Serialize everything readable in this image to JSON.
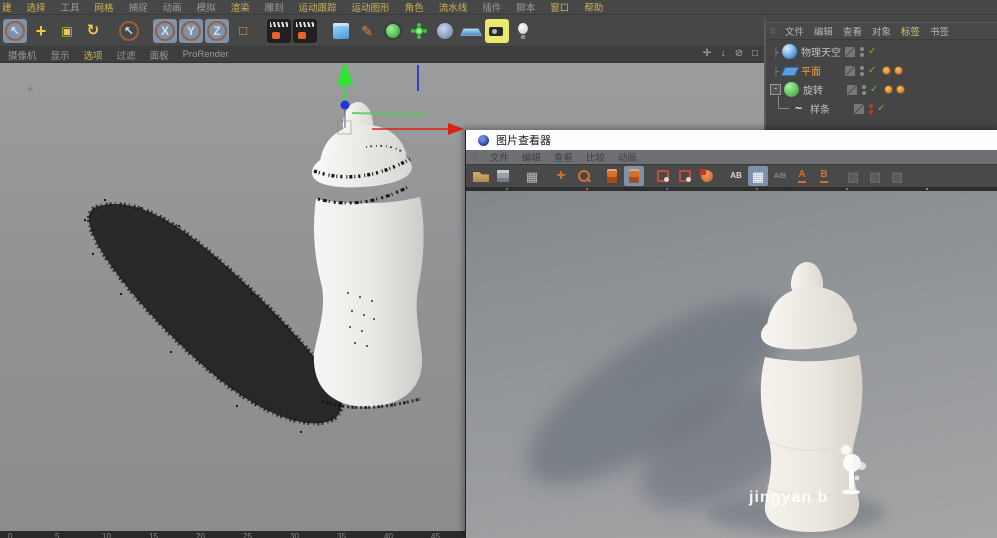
{
  "colors": {
    "accent_orange": "#e8a33d",
    "selected_blue": "#7d93ad",
    "camera_highlight": "#e9e96e",
    "check_green": "#57c13a",
    "tag_orange": "#c87820",
    "axis_red": "#dd2211",
    "axis_green": "#2ee62e",
    "axis_blue": "#2233dd",
    "menu_highlight": "#c9b35a"
  },
  "main_menu": {
    "items": [
      {
        "label": "建",
        "tone": "hl"
      },
      {
        "label": "选择",
        "tone": "hl"
      },
      {
        "label": "工具",
        "tone": "dim"
      },
      {
        "label": "网格",
        "tone": "hl"
      },
      {
        "label": "捕捉",
        "tone": "dim"
      },
      {
        "label": "动画",
        "tone": "dim"
      },
      {
        "label": "模拟",
        "tone": "dim"
      },
      {
        "label": "渲染",
        "tone": "hl"
      },
      {
        "label": "雕刻",
        "tone": "dim"
      },
      {
        "label": "运动跟踪",
        "tone": "hl"
      },
      {
        "label": "运动图形",
        "tone": "hl"
      },
      {
        "label": "角色",
        "tone": "hl"
      },
      {
        "label": "流水线",
        "tone": "hl"
      },
      {
        "label": "插件",
        "tone": "dim"
      },
      {
        "label": "脚本",
        "tone": "dim"
      },
      {
        "label": "窗口",
        "tone": "hl"
      },
      {
        "label": "帮助",
        "tone": "hl"
      }
    ]
  },
  "main_toolbar": {
    "icons": [
      {
        "name": "live-selection",
        "glyph": "↖",
        "selected": true,
        "ring": true
      },
      {
        "name": "move",
        "glyph": "+"
      },
      {
        "name": "scale",
        "glyph": "▣"
      },
      {
        "name": "rotate",
        "glyph": "↻"
      },
      {
        "name": "sep"
      },
      {
        "name": "last-tool",
        "glyph": "↖",
        "ring": true
      },
      {
        "name": "sep"
      },
      {
        "name": "lock-x",
        "glyph": "X",
        "selected": true,
        "ring": true
      },
      {
        "name": "lock-y",
        "glyph": "Y",
        "selected": true,
        "ring": true
      },
      {
        "name": "lock-z",
        "glyph": "Z",
        "selected": true,
        "ring": true
      },
      {
        "name": "coord-system",
        "glyph": "□"
      },
      {
        "name": "sep"
      },
      {
        "name": "render-view"
      },
      {
        "name": "render-settings"
      },
      {
        "name": "sep"
      },
      {
        "name": "add-cube"
      },
      {
        "name": "spline-pen",
        "glyph": "✎"
      },
      {
        "name": "subdivision"
      },
      {
        "name": "mograph"
      },
      {
        "name": "volume"
      },
      {
        "name": "floor"
      },
      {
        "name": "camera",
        "highlight": true
      },
      {
        "name": "light"
      }
    ]
  },
  "viewport_bar": {
    "items": [
      {
        "label": "摄像机",
        "tone": "dim"
      },
      {
        "label": "显示",
        "tone": "dim"
      },
      {
        "label": "选项",
        "tone": "hl"
      },
      {
        "label": "过滤",
        "tone": "dim"
      },
      {
        "label": "面板",
        "tone": "dim"
      },
      {
        "label": "ProRender",
        "tone": "dim"
      }
    ],
    "nav_icons": [
      {
        "name": "pan-view",
        "glyph": "✛"
      },
      {
        "name": "zoom-view",
        "glyph": "↓"
      },
      {
        "name": "rotate-view",
        "glyph": "⊘"
      },
      {
        "name": "toggle-view",
        "glyph": "□"
      }
    ]
  },
  "object_manager": {
    "menu": [
      {
        "label": "文件",
        "tone": "dim"
      },
      {
        "label": "编辑",
        "tone": "dim"
      },
      {
        "label": "查看",
        "tone": "dim"
      },
      {
        "label": "对象",
        "tone": "dim"
      },
      {
        "label": "标签",
        "tone": "hl"
      },
      {
        "label": "书签",
        "tone": "dim"
      }
    ],
    "objects": [
      {
        "name": "物理天空",
        "icon": "sky",
        "selected": false,
        "expander": "tick",
        "dots": [
          "#8a8a8a",
          "#8a8a8a"
        ],
        "check": true,
        "tags": 0
      },
      {
        "name": "平面",
        "icon": "plane",
        "selected": true,
        "expander": "tick",
        "dots": [
          "#8a8a8a",
          "#8a8a8a"
        ],
        "check": true,
        "tags": 2
      },
      {
        "name": "旋转",
        "icon": "lathe",
        "selected": false,
        "expander": "minus",
        "dots": [
          "#8a8a8a",
          "#8a8a8a"
        ],
        "check": true,
        "tags": 2
      },
      {
        "name": "样条",
        "icon": "spline",
        "selected": false,
        "expander": "child",
        "dots": [
          "#c23a2a",
          "#c23a2a"
        ],
        "check": true,
        "tags": 0
      }
    ]
  },
  "picture_viewer": {
    "title": "图片查看器",
    "menu": [
      "文件",
      "编辑",
      "查看",
      "比较",
      "动画"
    ],
    "toolbar": [
      {
        "k": "folder",
        "name": "open-image"
      },
      {
        "k": "floppy",
        "name": "save-image"
      },
      {
        "k": "sep"
      },
      {
        "k": "thumbs",
        "name": "history-thumbnails",
        "glyph": "▦"
      },
      {
        "k": "sep"
      },
      {
        "k": "navmove",
        "name": "pan-tool",
        "glyph": "+"
      },
      {
        "k": "navzoom",
        "name": "zoom-tool"
      },
      {
        "k": "sep"
      },
      {
        "k": "hist",
        "name": "histogram"
      },
      {
        "k": "hist",
        "name": "info-panel",
        "sel": true
      },
      {
        "k": "sep"
      },
      {
        "k": "frame",
        "name": "compare-frame-a"
      },
      {
        "k": "frame",
        "name": "compare-frame-b"
      },
      {
        "k": "filmeye",
        "name": "film-eye"
      },
      {
        "k": "sep"
      },
      {
        "k": "ab",
        "name": "ab-compare",
        "glyph": "AB"
      },
      {
        "k": "thumbs",
        "name": "layout-grid",
        "glyph": "▦",
        "sel": true
      },
      {
        "k": "abs",
        "name": "ab-swap",
        "glyph": "A/B"
      },
      {
        "k": "a",
        "name": "set-a",
        "glyph": "A"
      },
      {
        "k": "b",
        "name": "set-b",
        "glyph": "B"
      },
      {
        "k": "sep"
      },
      {
        "k": "gray",
        "name": "disabled-1",
        "glyph": "▨"
      },
      {
        "k": "gray",
        "name": "disabled-2",
        "glyph": "▨"
      },
      {
        "k": "gray",
        "name": "disabled-3",
        "glyph": "▨"
      }
    ],
    "watermark": "jingyan b"
  },
  "timeline": {
    "ticks": [
      "0",
      "5",
      "10",
      "15",
      "20",
      "25",
      "30",
      "35",
      "40",
      "45"
    ]
  }
}
